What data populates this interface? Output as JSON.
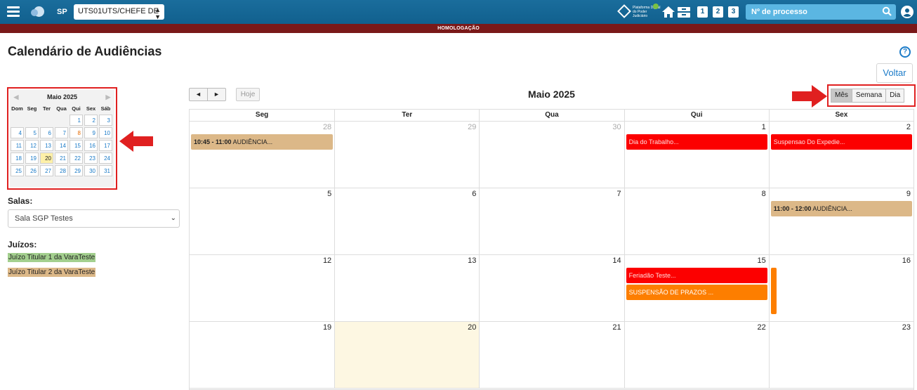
{
  "topbar": {
    "sp_label": "SP",
    "unit_select_value": "UTS01UTS/CHEFE DE",
    "pdpj_logo_text": "Plataforma Digital do Poder Judiciário",
    "num_buttons": [
      "1",
      "2",
      "3"
    ],
    "process_search_placeholder": "Nº de processo",
    "bar_color": "#11608e"
  },
  "environment_banner": "HOMOLOGAÇÃO",
  "page": {
    "title": "Calendário de Audiências",
    "help_symbol": "?",
    "back_button": "Voltar"
  },
  "mini_calendar": {
    "month_label": "Maio 2025",
    "weekdays": [
      "Dom",
      "Seg",
      "Ter",
      "Qua",
      "Qui",
      "Sex",
      "Sáb"
    ],
    "days": [
      "",
      "",
      "",
      "",
      "1",
      "2",
      "3",
      "4",
      "5",
      "6",
      "7",
      "8",
      "9",
      "10",
      "11",
      "12",
      "13",
      "14",
      "15",
      "16",
      "17",
      "18",
      "19",
      "20",
      "21",
      "22",
      "23",
      "24",
      "25",
      "26",
      "27",
      "28",
      "29",
      "30",
      "31"
    ],
    "highlighted_holidays": [
      "8"
    ],
    "today": "20"
  },
  "filters": {
    "salas_label": "Salas:",
    "salas_selected": "Sala SGP Testes",
    "juizos_label": "Juízos:",
    "juizos": [
      {
        "name": "Juízo Titular 1 da VaraTeste",
        "color": "#a3cf8e"
      },
      {
        "name": "Juízo Titular 2 da VaraTeste",
        "color": "#dcb888"
      }
    ]
  },
  "calendar": {
    "prev_symbol": "◄",
    "next_symbol": "►",
    "today_button": "Hoje",
    "title": "Maio 2025",
    "views": [
      "Mês",
      "Semana",
      "Dia"
    ],
    "active_view": "Mês",
    "weekday_headers": [
      "Seg",
      "Ter",
      "Qua",
      "Qui",
      "Sex"
    ],
    "weeks": [
      [
        "28",
        "29",
        "30",
        "1",
        "2"
      ],
      [
        "5",
        "6",
        "7",
        "8",
        "9"
      ],
      [
        "12",
        "13",
        "14",
        "15",
        "16"
      ],
      [
        "19",
        "20",
        "21",
        "22",
        "23"
      ]
    ],
    "today_day": "20",
    "events": [
      {
        "day": "28",
        "time": "10:45 - 11:00",
        "title": "AUDIÊNCIA...",
        "color": "#dcb888"
      },
      {
        "day": "1",
        "time": "",
        "title": "Dia do Trabalho...",
        "color": "#fc0000"
      },
      {
        "day": "2",
        "time": "",
        "title": "Suspensao Do Expedie...",
        "color": "#fc0000"
      },
      {
        "day": "9",
        "time": "11:00 - 12:00",
        "title": "AUDIÊNCIA...",
        "color": "#dcb888"
      },
      {
        "day": "15",
        "time": "",
        "title": "Feriadão Teste...",
        "color": "#fc0000"
      },
      {
        "day": "15",
        "time": "",
        "title": "SUSPENSÃO DE PRAZOS ...",
        "color": "#fd7e00"
      }
    ]
  },
  "annotations": {
    "arrow_color": "#e02020"
  }
}
